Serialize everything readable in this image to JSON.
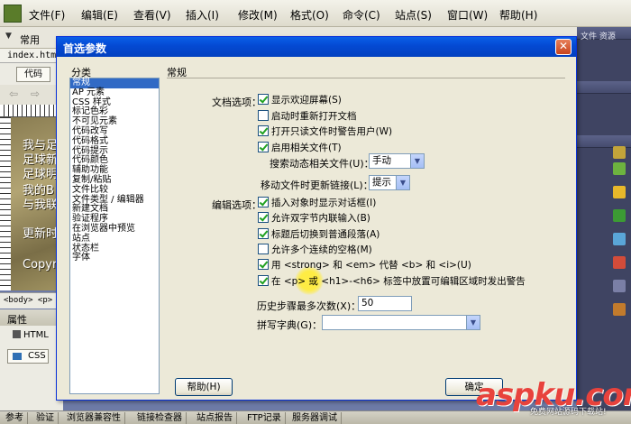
{
  "app": {
    "menu": [
      "文件(F)",
      "编辑(E)",
      "查看(V)",
      "插入(I)",
      "修改(M)",
      "格式(O)",
      "命令(C)",
      "站点(S)",
      "窗口(W)",
      "帮助(H)"
    ],
    "insert_bar_label": "常用",
    "doc_tab": "index.html",
    "code_button": "代码",
    "canvas_lines": [
      "我与足",
      "足球新",
      "足球明",
      "我的B",
      "与我联",
      "更新时",
      "Copyri"
    ],
    "tag_path": "<body> <p>",
    "properties_title": "属性",
    "html_button": "HTML",
    "css_button": "CSS",
    "bottom_tabs": [
      "参考",
      "验证",
      "浏览器兼容性",
      "链接检查器",
      "站点报告",
      "FTP记录",
      "服务器调试"
    ],
    "side_panel_title": "文件 资源"
  },
  "dialog": {
    "title": "首选参数",
    "close_glyph": "✕",
    "category_label": "分类",
    "categories": [
      "常规",
      "AP 元素",
      "CSS 样式",
      "标记色彩",
      "不可见元素",
      "代码改写",
      "代码格式",
      "代码提示",
      "代码颜色",
      "辅助功能",
      "复制/粘贴",
      "文件比较",
      "文件类型 / 编辑器",
      "新建文档",
      "验证程序",
      "在浏览器中预览",
      "站点",
      "状态栏",
      "字体"
    ],
    "selected_category": 0,
    "section_title": "常规",
    "doc_options_label": "文档选项：",
    "doc_options": [
      {
        "label": "显示欢迎屏幕(S)",
        "checked": true
      },
      {
        "label": "启动时重新打开文档",
        "checked": false
      },
      {
        "label": "打开只读文件时警告用户(W)",
        "checked": true
      },
      {
        "label": "启用相关文件(T)",
        "checked": true
      }
    ],
    "search_related_label": "搜索动态相关文件(U)：",
    "search_related_value": "手动",
    "move_file_label": "移动文件时更新链接(L)：",
    "move_file_value": "提示",
    "edit_options_label": "编辑选项：",
    "edit_options": [
      {
        "label": "插入对象时显示对话框(I)",
        "checked": true
      },
      {
        "label": "允许双字节内联输入(B)",
        "checked": true
      },
      {
        "label": "标题后切换到普通段落(A)",
        "checked": true
      },
      {
        "label": "允许多个连续的空格(M)",
        "checked": false
      },
      {
        "label": "用 <strong> 和 <em> 代替 <b> 和 <i>(U)",
        "checked": true
      },
      {
        "label": "在 <p> 或 <h1>-<h6> 标签中放置可编辑区域时发出警告",
        "checked": true
      }
    ],
    "history_label": "历史步骤最多次数(X)：",
    "history_value": "50",
    "spell_dict_label": "拼写字典(G)：",
    "spell_dict_value": "",
    "help_button": "帮助(H)",
    "ok_button": "确定"
  },
  "watermark": {
    "text": "aspku.com",
    "sub": "免费网站源码下载站!"
  },
  "colors": {
    "titlebar": "#0449d2",
    "selection": "#316ac5",
    "watermark": "#e8423c"
  }
}
